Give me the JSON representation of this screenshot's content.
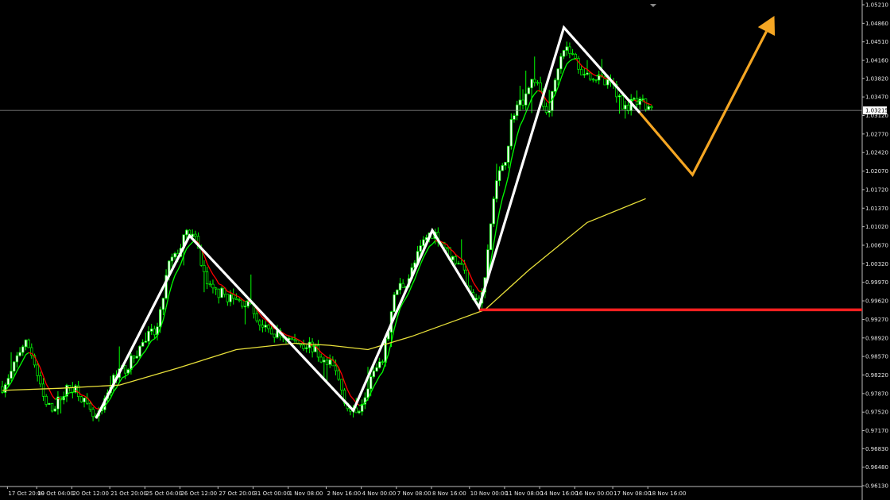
{
  "chart_data": {
    "type": "candlestick",
    "colors": {
      "background": "#000000",
      "bull_candle": "#ffffff",
      "bear_candle": "#000000",
      "candle_outline": "#00ff00",
      "fast_ma_up": "#00ff00",
      "fast_ma_down": "#ff0000",
      "slow_ma": "#e8e03a",
      "zigzag": "#ffffff",
      "projection": "#f5a623",
      "support_line": "#ff2020",
      "current_price_line": "#9a9a9a"
    },
    "y_axis": {
      "min": 0.9613,
      "max": 1.0521,
      "ticks": [
        "1.05210",
        "1.04860",
        "1.04510",
        "1.04160",
        "1.03820",
        "1.03470",
        "1.03120",
        "1.02770",
        "1.02420",
        "1.02070",
        "1.01720",
        "1.01370",
        "1.01020",
        "1.00670",
        "1.00320",
        "0.99970",
        "0.99620",
        "0.99270",
        "0.98920",
        "0.98570",
        "0.98220",
        "0.97870",
        "0.97520",
        "0.97170",
        "0.96830",
        "0.96480",
        "0.96130"
      ]
    },
    "x_axis": {
      "bar_count": 200,
      "labels": [
        {
          "bar": 2,
          "text": "17 Oct 20:00"
        },
        {
          "bar": 12,
          "text": "19 Oct 04:00"
        },
        {
          "bar": 24,
          "text": "20 Oct 12:00"
        },
        {
          "bar": 37,
          "text": "21 Oct 20:00"
        },
        {
          "bar": 49,
          "text": "25 Oct 04:00"
        },
        {
          "bar": 61,
          "text": "26 Oct 12:00"
        },
        {
          "bar": 74,
          "text": "27 Oct 20:00"
        },
        {
          "bar": 86,
          "text": "31 Oct 00:00"
        },
        {
          "bar": 98,
          "text": "1 Nov 08:00"
        },
        {
          "bar": 111,
          "text": "2 Nov 16:00"
        },
        {
          "bar": 123,
          "text": "4 Nov 00:00"
        },
        {
          "bar": 135,
          "text": "7 Nov 08:00"
        },
        {
          "bar": 147,
          "text": "8 Nov 16:00"
        },
        {
          "bar": 160,
          "text": "10 Nov 00:00"
        },
        {
          "bar": 172,
          "text": "11 Nov 08:00"
        },
        {
          "bar": 184,
          "text": "14 Nov 16:00"
        },
        {
          "bar": 196,
          "text": "16 Nov 00:00"
        },
        {
          "bar": 209,
          "text": "17 Nov 08:00"
        },
        {
          "bar": 221,
          "text": "18 Nov 16:00"
        }
      ]
    },
    "current_price": {
      "value": 1.03215,
      "label": "1.03215"
    },
    "support_level": 0.9945,
    "zigzag_points": [
      {
        "bar": 32,
        "price": 0.974
      },
      {
        "bar": 64,
        "price": 1.0085
      },
      {
        "bar": 120,
        "price": 0.9755
      },
      {
        "bar": 147,
        "price": 1.0095
      },
      {
        "bar": 163,
        "price": 0.995
      },
      {
        "bar": 192,
        "price": 1.0478
      },
      {
        "bar": 218,
        "price": 1.0317
      }
    ],
    "projection_points": [
      {
        "bar": 218,
        "price": 1.0317
      },
      {
        "bar": 236,
        "price": 1.02
      },
      {
        "bar": 264,
        "price": 1.05
      }
    ],
    "slow_ma_points": [
      {
        "bar": 0,
        "price": 0.9793
      },
      {
        "bar": 20,
        "price": 0.9797
      },
      {
        "bar": 40,
        "price": 0.9803
      },
      {
        "bar": 60,
        "price": 0.9835
      },
      {
        "bar": 80,
        "price": 0.987
      },
      {
        "bar": 100,
        "price": 0.9882
      },
      {
        "bar": 112,
        "price": 0.9878
      },
      {
        "bar": 125,
        "price": 0.987
      },
      {
        "bar": 140,
        "price": 0.9895
      },
      {
        "bar": 155,
        "price": 0.9925
      },
      {
        "bar": 165,
        "price": 0.9945
      },
      {
        "bar": 180,
        "price": 1.002
      },
      {
        "bar": 200,
        "price": 1.011
      },
      {
        "bar": 220,
        "price": 1.0155
      }
    ],
    "key_points": [
      {
        "bar": 0,
        "price": 0.98
      },
      {
        "bar": 8,
        "price": 0.988
      },
      {
        "bar": 16,
        "price": 0.976
      },
      {
        "bar": 24,
        "price": 0.98
      },
      {
        "bar": 32,
        "price": 0.974
      },
      {
        "bar": 40,
        "price": 0.983
      },
      {
        "bar": 52,
        "price": 0.99
      },
      {
        "bar": 58,
        "price": 1.004
      },
      {
        "bar": 64,
        "price": 1.009
      },
      {
        "bar": 72,
        "price": 0.998
      },
      {
        "bar": 82,
        "price": 0.996
      },
      {
        "bar": 92,
        "price": 0.99
      },
      {
        "bar": 104,
        "price": 0.988
      },
      {
        "bar": 112,
        "price": 0.984
      },
      {
        "bar": 120,
        "price": 0.975
      },
      {
        "bar": 128,
        "price": 0.983
      },
      {
        "bar": 136,
        "price": 0.999
      },
      {
        "bar": 147,
        "price": 1.009
      },
      {
        "bar": 155,
        "price": 1.004
      },
      {
        "bar": 163,
        "price": 0.996
      },
      {
        "bar": 170,
        "price": 1.02
      },
      {
        "bar": 176,
        "price": 1.033
      },
      {
        "bar": 182,
        "price": 1.038
      },
      {
        "bar": 186,
        "price": 1.032
      },
      {
        "bar": 192,
        "price": 1.044
      },
      {
        "bar": 200,
        "price": 1.039
      },
      {
        "bar": 208,
        "price": 1.037
      },
      {
        "bar": 213,
        "price": 1.033
      },
      {
        "bar": 218,
        "price": 1.0335
      },
      {
        "bar": 222,
        "price": 1.032
      }
    ]
  }
}
